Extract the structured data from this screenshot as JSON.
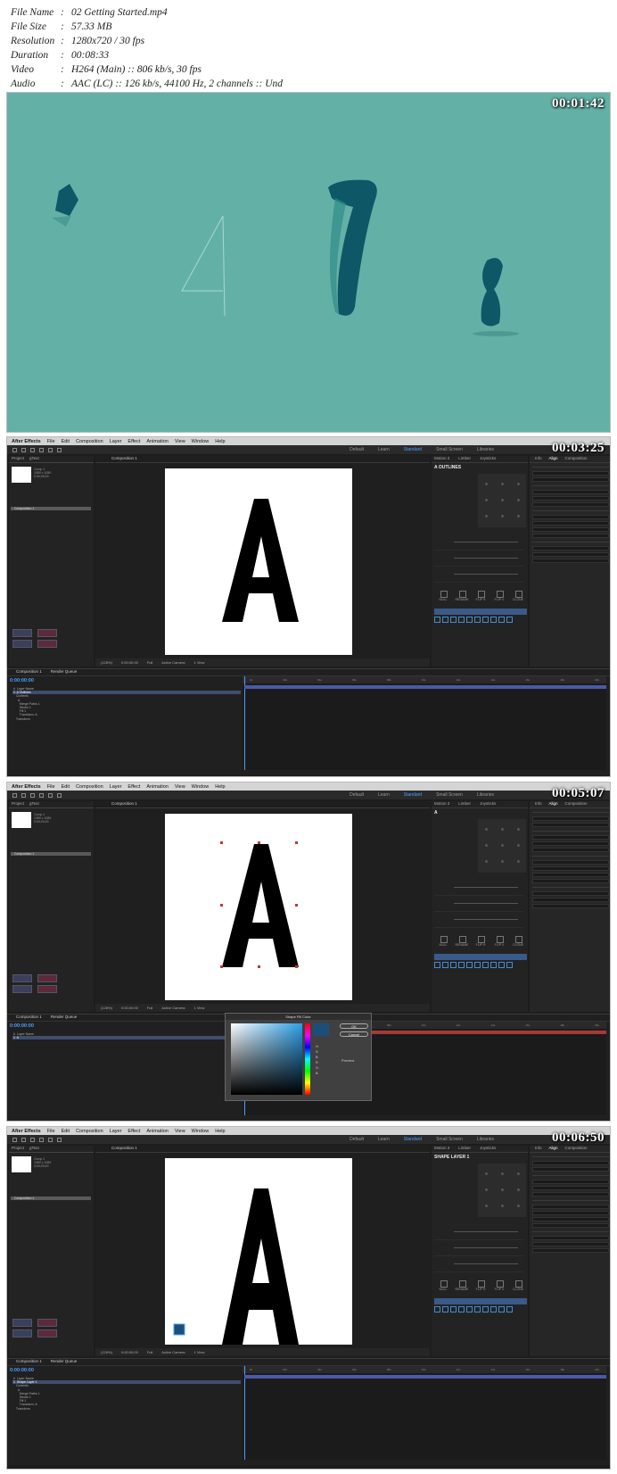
{
  "meta": {
    "rows": [
      {
        "k": "File Name",
        "v": "02 Getting Started.mp4"
      },
      {
        "k": "File Size",
        "v": "57.33 MB"
      },
      {
        "k": "Resolution",
        "v": "1280x720 / 30 fps"
      },
      {
        "k": "Duration",
        "v": "00:08:33"
      },
      {
        "k": "Video",
        "v": "H264 (Main) :: 806 kb/s, 30 fps"
      },
      {
        "k": "Audio",
        "v": "AAC (LC) :: 126 kb/s, 44100 Hz, 2 channels :: Und"
      }
    ]
  },
  "frames": [
    {
      "timestamp": "00:01:42"
    },
    {
      "timestamp": "00:03:25",
      "panel_title": "A OUTLINES",
      "timecode": "0:00:00:00",
      "comp_tab": "Composition 1",
      "layer": "A Outlines"
    },
    {
      "timestamp": "00:05:07",
      "panel_title": "A",
      "timecode": "0:00:00:00",
      "comp_tab": "Composition 1",
      "layer": "A"
    },
    {
      "timestamp": "00:06:50",
      "panel_title": "SHAPE LAYER 1",
      "timecode": "0:00:00:00",
      "comp_tab": "Composition 1",
      "layer": "Shape Layer 1"
    }
  ],
  "menubar": {
    "app": "After Effects",
    "items": [
      "File",
      "Edit",
      "Composition",
      "Layer",
      "Effect",
      "Animation",
      "View",
      "Window",
      "Help"
    ]
  },
  "workspaces": [
    "Default",
    "Learn",
    "Standard",
    "Small Screen",
    "Libraries"
  ],
  "buttons": [
    "NULL",
    "RENAME",
    "FLIP H",
    "FLIP V",
    "CLONE"
  ],
  "dialog": {
    "title": "Shape Fill Color",
    "ok": "OK",
    "cancel": "Cancel",
    "preview": "Preview"
  },
  "colors": {
    "teal_bg": "#63b1a6",
    "teal_dark": "#0e5767",
    "ae_bg": "#1d1d1d",
    "accent": "#4aa0ff"
  }
}
